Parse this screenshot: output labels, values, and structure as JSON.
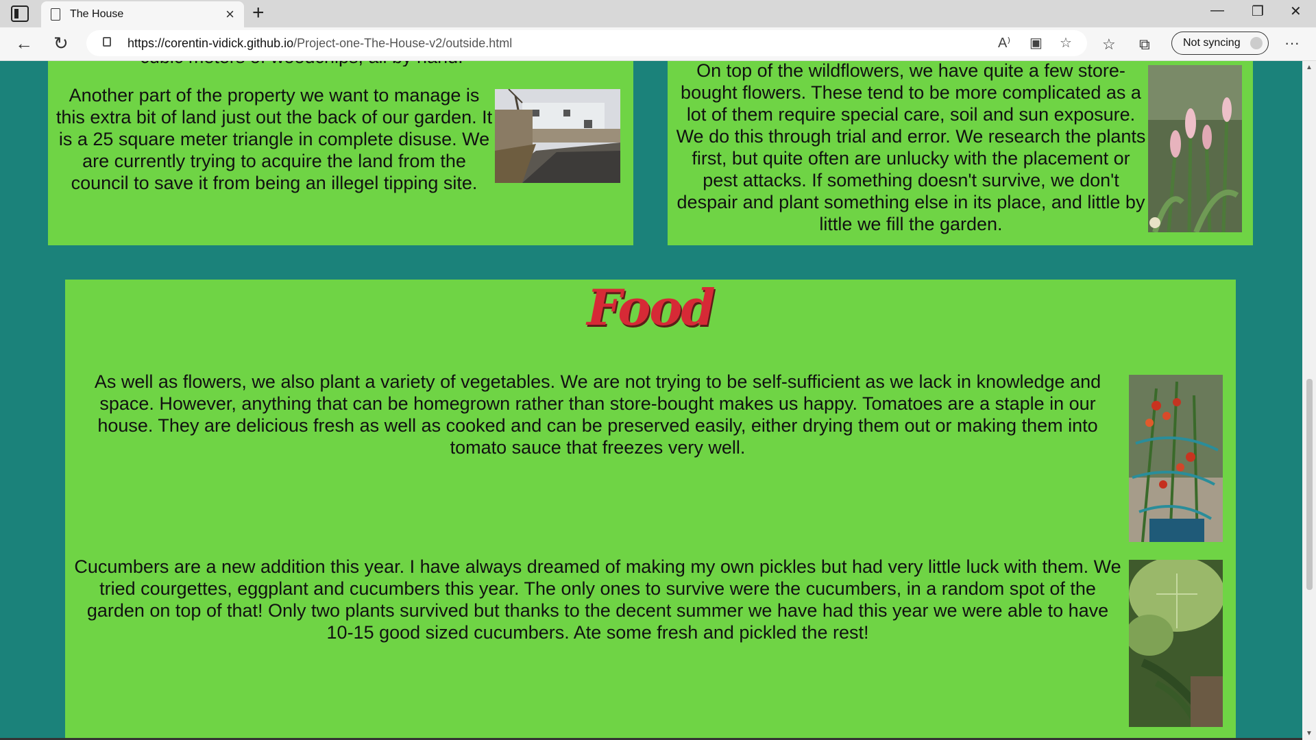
{
  "browser": {
    "tab_title": "The House",
    "url_host": "https://corentin-vidick.github.io",
    "url_path": "/Project-one-The-House-v2/outside.html",
    "sync_label": "Not syncing"
  },
  "cards": {
    "land_cut_text": "cubic meters of woodchips, all by hand.",
    "land_text": "Another part of the property we want to manage is this extra bit of land just out the back of our garden. It is a 25 square meter triangle in complete disuse. We are currently trying to acquire the land from the council to save it from being an illegel tipping site.",
    "flowers_text": "On top of the wildflowers, we have quite a few store-bought flowers. These tend to be more complicated as a lot of them require special care, soil and sun exposure. We do this through trial and error. We research the plants first, but quite often are unlucky with the placement or pest attacks. If something doesn't survive, we don't despair and plant something else in its place, and little by little we fill the garden."
  },
  "food": {
    "title": "Food",
    "paragraph1": "As well as flowers, we also plant a variety of vegetables. We are not trying to be self-sufficient as we lack in knowledge and space. However, anything that can be homegrown rather than store-bought makes us happy. Tomatoes are a staple in our house. They are delicious fresh as well as cooked and can be preserved easily, either drying them out or making them into tomato sauce that freezes very well.",
    "paragraph2": "Cucumbers are a new addition this year. I have always dreamed of making my own pickles but had very little luck with them. We tried courgettes, eggplant and cucumbers this year. The only ones to survive were the cucumbers, in a random spot of the garden on top of that! Only two plants survived but thanks to the decent summer we have had this year we were able to have 10-15 good sized cucumbers. Ate some fresh and pickled the rest!"
  },
  "colors": {
    "page_bg": "#1b827a",
    "card_bg": "#6fd445",
    "title_red": "#d62a36"
  }
}
